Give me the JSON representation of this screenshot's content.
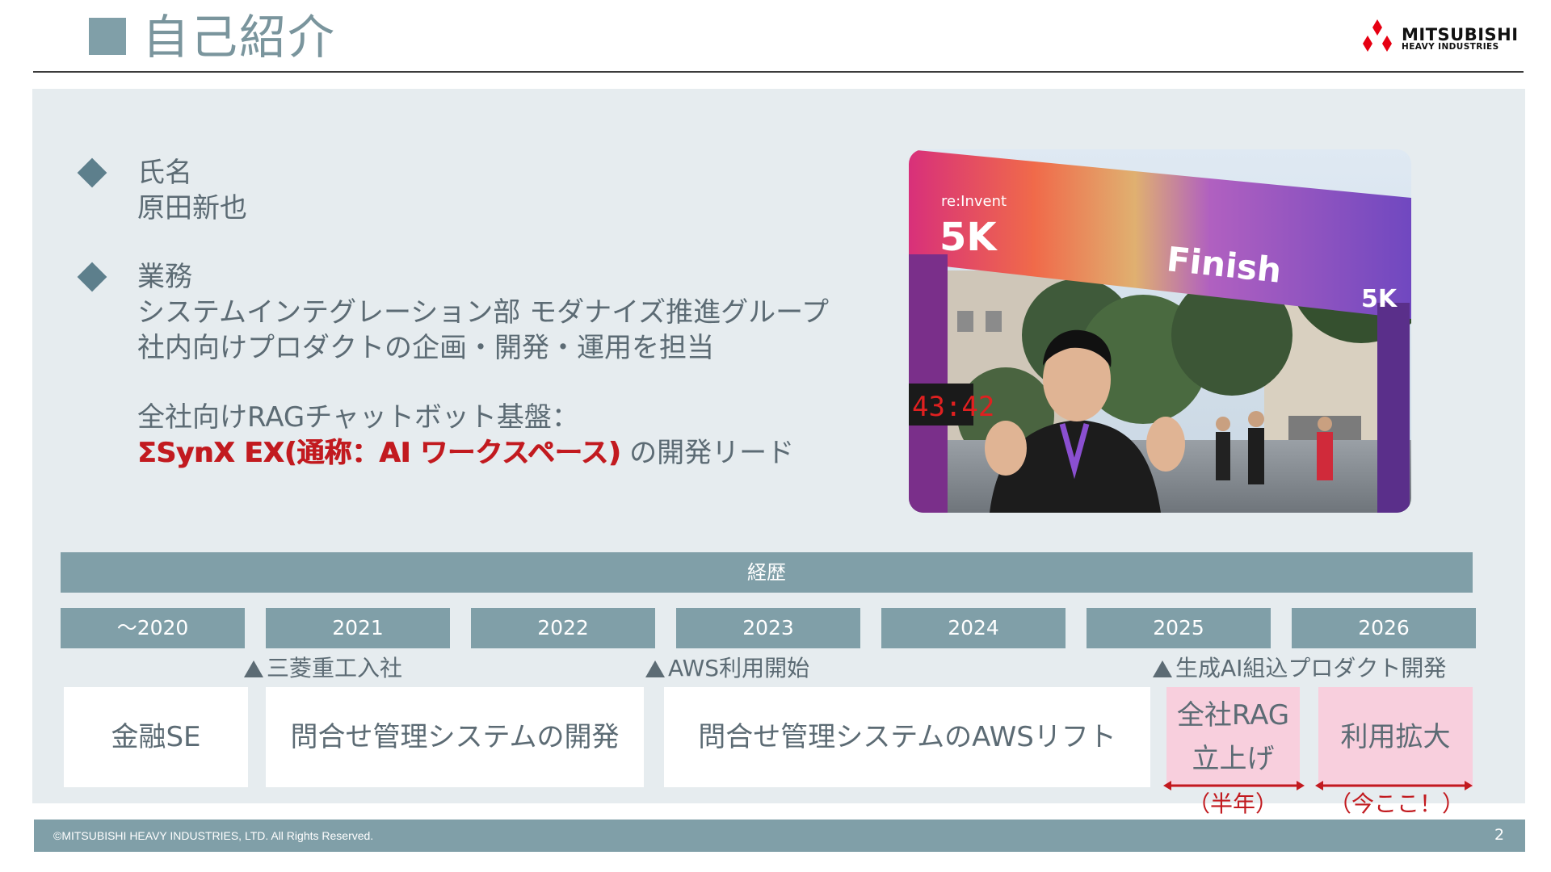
{
  "header": {
    "title": "自己紹介"
  },
  "logo": {
    "text_line1": "MITSUBISHI",
    "text_line2": "HEAVY INDUSTRIES"
  },
  "profile": {
    "name_label": "氏名",
    "name_value": "原田新也",
    "duty_label": "業務",
    "duty_line1": "システムインテグレーション部 モダナイズ推進グループ",
    "duty_line2": "社内向けプロダクトの企画・開発・運用を担当",
    "rag_line1": "全社向けRAGチャットボット基盤：",
    "rag_product": "ΣSynX EX(通称：AI ワークスペース)",
    "rag_suffix": " の開発リード"
  },
  "photo": {
    "banner_text": "Finish",
    "event_text": "5K",
    "event_brand": "re:Invent",
    "clock": "43:42"
  },
  "career": {
    "title": "経歴",
    "years": [
      "～2020",
      "2021",
      "2022",
      "2023",
      "2024",
      "2025",
      "2026"
    ],
    "milestones": [
      {
        "label": "三菱重工入社"
      },
      {
        "label": "AWS利用開始"
      },
      {
        "label": "生成AI組込プロダクト開発"
      }
    ],
    "phases": [
      {
        "label": "金融SE"
      },
      {
        "label": "問合せ管理システムの開発"
      },
      {
        "label": "問合せ管理システムのAWSリフト"
      },
      {
        "label_line1": "全社RAG",
        "label_line2": "立上げ",
        "note": "（半年）"
      },
      {
        "label": "利用拡大",
        "note": "（今ここ！）"
      }
    ]
  },
  "footer": {
    "copyright": "©MITSUBISHI HEAVY INDUSTRIES, LTD.  All Rights Reserved.",
    "page": "2"
  },
  "colors": {
    "accent": "#809fa8",
    "panel": "#e6ecef",
    "highlight": "#f8cfdd",
    "red": "#c21a1f"
  }
}
